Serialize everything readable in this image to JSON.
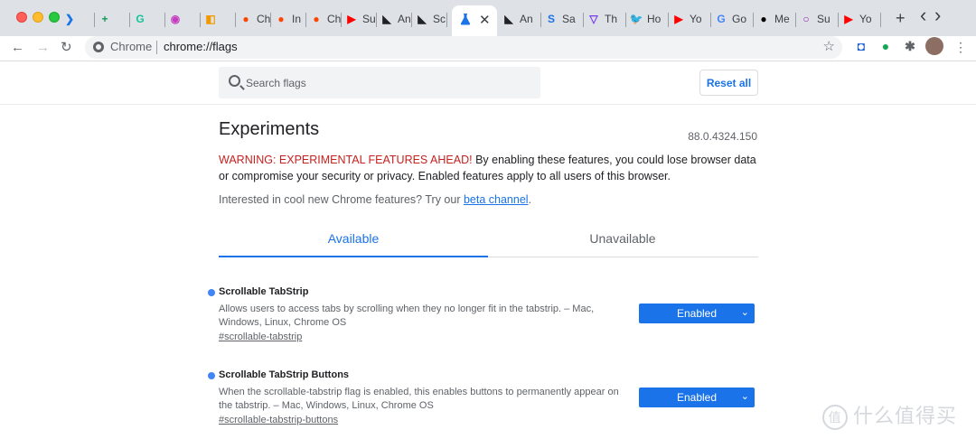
{
  "tabs": {
    "favicons": [
      {
        "glyph": "❯",
        "color": "#1a73e8",
        "label": ""
      },
      {
        "glyph": "+",
        "color": "#0f9d58",
        "label": ""
      },
      {
        "glyph": "G",
        "color": "#15c39a",
        "label": ""
      },
      {
        "glyph": "◉",
        "color": "#c53bc1",
        "label": ""
      },
      {
        "glyph": "◧",
        "color": "#f29900",
        "label": ""
      },
      {
        "glyph": "●",
        "color": "#ff4500",
        "label": "Ch"
      },
      {
        "glyph": "●",
        "color": "#ff4500",
        "label": "In"
      },
      {
        "glyph": "●",
        "color": "#ff4500",
        "label": "Ch"
      },
      {
        "glyph": "▶",
        "color": "#ff0000",
        "label": "Su"
      },
      {
        "glyph": "◣",
        "color": "#202124",
        "label": "An"
      },
      {
        "glyph": "◣",
        "color": "#202124",
        "label": "Sc"
      }
    ],
    "active_icon": "flask-icon",
    "right_tabs": [
      {
        "glyph": "◣",
        "color": "#202124",
        "label": "An"
      },
      {
        "glyph": "S",
        "color": "#1a73e8",
        "label": "Sa"
      },
      {
        "glyph": "▽",
        "color": "#7c3aed",
        "label": "Th"
      },
      {
        "glyph": "🐦",
        "color": "#1da1f2",
        "label": "Ho"
      },
      {
        "glyph": "▶",
        "color": "#ff0000",
        "label": "Yo"
      },
      {
        "glyph": "G",
        "color": "#4285f4",
        "label": "Go"
      },
      {
        "glyph": "●",
        "color": "#000000",
        "label": "Me"
      },
      {
        "glyph": "○",
        "color": "#8e24aa",
        "label": "Su"
      },
      {
        "glyph": "▶",
        "color": "#ff0000",
        "label": "Yo"
      }
    ],
    "new_tab": "+",
    "scroll_left": "‹",
    "scroll_right": "›"
  },
  "toolbar": {
    "back": "←",
    "forward": "→",
    "reload": "↻",
    "chip_label": "Chrome",
    "url": "chrome://flags",
    "star": "☆"
  },
  "extensions": [
    {
      "name": "bitwarden-icon",
      "glyph": "◘",
      "color": "#175ddc"
    },
    {
      "name": "grammarly-extension-icon",
      "glyph": "●",
      "color": "#15a655"
    },
    {
      "name": "puzzle-icon",
      "glyph": "✱",
      "color": "#5f6368"
    }
  ],
  "header": {
    "search_placeholder": "Search flags",
    "reset_label": "Reset all"
  },
  "main": {
    "title": "Experiments",
    "version": "88.0.4324.150",
    "warning_red": "WARNING: EXPERIMENTAL FEATURES AHEAD!",
    "warning_rest": " By enabling these features, you could lose browser data or compromise your security or privacy. Enabled features apply to all users of this browser.",
    "interest_prefix": "Interested in cool new Chrome features? Try our ",
    "interest_link": "beta channel",
    "interest_suffix": ".",
    "tab_available": "Available",
    "tab_unavailable": "Unavailable"
  },
  "flags": [
    {
      "name": "Scrollable TabStrip",
      "description": "Allows users to access tabs by scrolling when they no longer fit in the tabstrip. – Mac, Windows, Linux, Chrome OS",
      "link": "#scrollable-tabstrip",
      "value": "Enabled"
    },
    {
      "name": "Scrollable TabStrip Buttons",
      "description": "When the scrollable-tabstrip flag is enabled, this enables buttons to permanently appear on the tabstrip. – Mac, Windows, Linux, Chrome OS",
      "link": "#scrollable-tabstrip-buttons",
      "value": "Enabled"
    }
  ],
  "watermark": {
    "badge": "值",
    "text": "什么值得买"
  }
}
